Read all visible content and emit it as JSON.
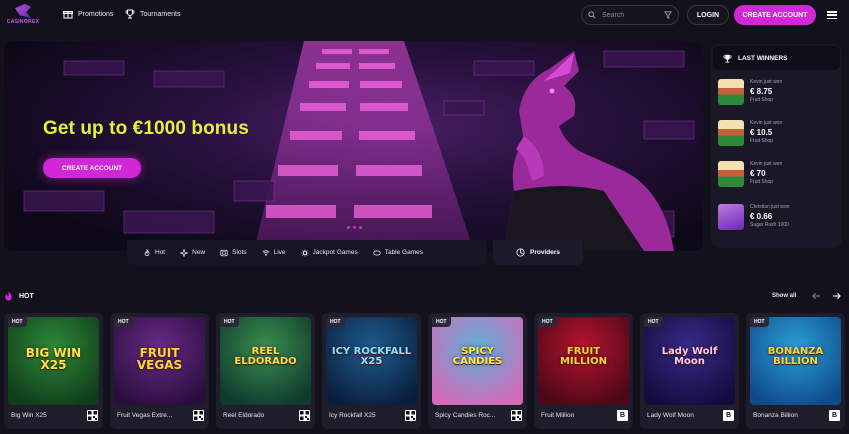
{
  "brand": {
    "logo_text": "CASINOREX",
    "accent": "#d127d8",
    "highlight": "#e5f03c"
  },
  "header": {
    "nav": [
      {
        "label": "Promotions",
        "icon": "gift-icon"
      },
      {
        "label": "Tournaments",
        "icon": "trophy-icon"
      }
    ],
    "search_placeholder": "Search",
    "login_label": "LOGIN",
    "create_account_label": "CREATE ACCOUNT"
  },
  "hero": {
    "title": "Get up to €1000 bonus",
    "cta_label": "CREATE ACCOUNT",
    "slides": 3,
    "active_slide": 1
  },
  "categories": [
    {
      "label": "Hot",
      "icon": "flame-icon"
    },
    {
      "label": "New",
      "icon": "sparkle-icon"
    },
    {
      "label": "Slots",
      "icon": "slot-icon"
    },
    {
      "label": "Live",
      "icon": "live-icon"
    },
    {
      "label": "Jackpot Games",
      "icon": "jackpot-icon"
    },
    {
      "label": "Table Games",
      "icon": "cards-icon"
    }
  ],
  "providers_label": "Providers",
  "winners": {
    "title": "LAST WINNERS",
    "items": [
      {
        "who": "Kevin just won",
        "amount": "€ 8.75",
        "game": "Fruit Shop"
      },
      {
        "who": "Kevin just won",
        "amount": "€ 10.5",
        "game": "Fruit Shop"
      },
      {
        "who": "Kevin just won",
        "amount": "€ 70",
        "game": "Fruit Shop"
      },
      {
        "who": "Christian just won",
        "amount": "€ 0.66",
        "game": "Sugar Rush 1000"
      }
    ]
  },
  "hot": {
    "title": "HOT",
    "show_all": "Show all",
    "badge": "HOT",
    "games": [
      {
        "name": "Big Win X25",
        "art_text": "BIG WIN X25",
        "provider_mark": "qr",
        "bg": "#2f8a3a",
        "bg2": "#0f3d1a",
        "text_color": "#ffe04a"
      },
      {
        "name": "Fruit Vegas Extre...",
        "art_text": "FRUIT VEGAS",
        "provider_mark": "qr",
        "bg": "#6a2a8a",
        "bg2": "#2a0f3d",
        "text_color": "#ffd23a"
      },
      {
        "name": "Reel Eldorado",
        "art_text": "REEL ELDORADO",
        "provider_mark": "qr",
        "bg": "#3a8f4e",
        "bg2": "#0f3a2e",
        "text_color": "#ffd94d"
      },
      {
        "name": "Icy Rockfall X25",
        "art_text": "ICY ROCKFALL X25",
        "provider_mark": "qr",
        "bg": "#1f5c8f",
        "bg2": "#0a1f3d",
        "text_color": "#8fe0ff"
      },
      {
        "name": "Spicy Candies Roc...",
        "art_text": "SPICY CANDIES",
        "provider_mark": "qr",
        "bg": "#5fb0d8",
        "bg2": "#d46ab8",
        "text_color": "#ffe94d"
      },
      {
        "name": "Fruit Million",
        "art_text": "FRUIT MILLION",
        "provider_mark": "B",
        "bg": "#b8142f",
        "bg2": "#4a0818",
        "text_color": "#ffd23a"
      },
      {
        "name": "Lady Wolf Moon",
        "art_text": "Lady Wolf Moon",
        "provider_mark": "B",
        "bg": "#3a2a8a",
        "bg2": "#140c3d",
        "text_color": "#ffc8e8"
      },
      {
        "name": "Bonanza Billion",
        "art_text": "BONANZA BILLION",
        "provider_mark": "B",
        "bg": "#2aa0d8",
        "bg2": "#0f4a8a",
        "text_color": "#ffd23a"
      }
    ]
  }
}
